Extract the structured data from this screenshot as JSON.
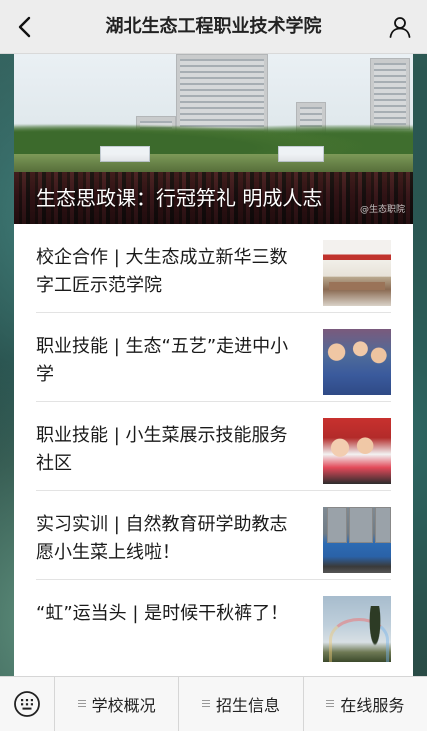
{
  "header": {
    "title": "湖北生态工程职业技术学院",
    "back_icon": "back-chevron-icon",
    "user_icon": "user-profile-icon"
  },
  "hero": {
    "caption": "生态思政课：行冠笄礼 明成人志",
    "watermark": "@生态职院"
  },
  "articles": [
    {
      "title": "校企合作 | 大生态成立新华三数字工匠示范学院",
      "thumbnail": "meeting-room-photo"
    },
    {
      "title": "职业技能 | 生态“五艺”走进中小学",
      "thumbnail": "children-with-flowers-photo"
    },
    {
      "title": "职业技能 | 小生菜展示技能服务社区",
      "thumbnail": "kids-activity-photo"
    },
    {
      "title": "实习实训 | 自然教育研学助教志愿小生菜上线啦！",
      "thumbnail": "volunteer-group-photo"
    },
    {
      "title": "“虹”运当头 | 是时候干秋裤了！",
      "thumbnail": "rainbow-sky-photo"
    }
  ],
  "bottom_menu": {
    "keyboard_icon": "keyboard-toggle-icon",
    "items": [
      {
        "label": "学校概况"
      },
      {
        "label": "招生信息"
      },
      {
        "label": "在线服务"
      }
    ]
  },
  "colors": {
    "topbar_bg": "#ededed",
    "card_bg": "#ffffff",
    "text_primary": "#1a1a1a",
    "divider": "#e3e3e3"
  }
}
